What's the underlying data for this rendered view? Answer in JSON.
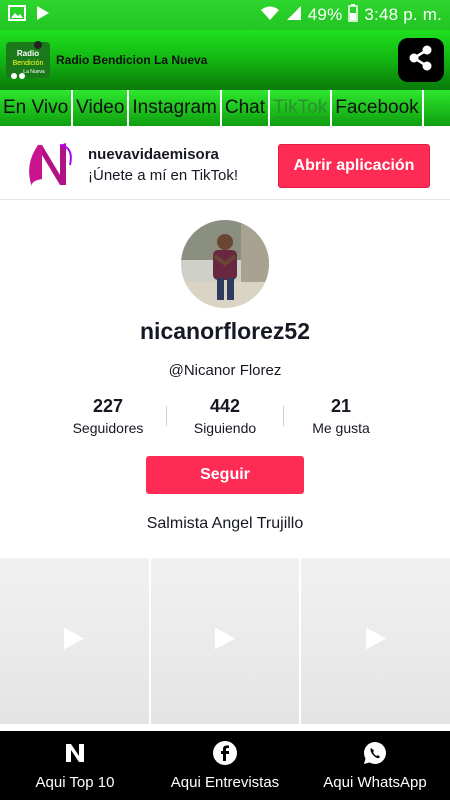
{
  "status_bar": {
    "battery": "49%",
    "time": "3:48 p. m.",
    "icons": [
      "image-icon",
      "play-icon",
      "wifi-icon",
      "signal-icon",
      "battery-icon"
    ]
  },
  "header": {
    "logo_text": "Radio Bendicion La Nueva",
    "title": "Radio Bendicion La Nueva",
    "share_icon": "share-icon"
  },
  "tabs": [
    {
      "label": "En Vivo"
    },
    {
      "label": "Video"
    },
    {
      "label": "Instagram"
    },
    {
      "label": "Chat"
    },
    {
      "label": "TikTok",
      "active": true
    },
    {
      "label": "Facebook"
    }
  ],
  "promo": {
    "account": "nuevavidaemisora",
    "tagline": "¡Únete a mí en TikTok!",
    "open_label": "Abrir aplicación"
  },
  "profile": {
    "username": "nicanorflorez52",
    "handle": "@Nicanor Florez",
    "stats": [
      {
        "value": "227",
        "label": "Seguidores"
      },
      {
        "value": "442",
        "label": "Siguiendo"
      },
      {
        "value": "21",
        "label": "Me gusta"
      }
    ],
    "follow_label": "Seguir",
    "bio": "Salmista Angel Trujillo"
  },
  "videos": [
    {
      "icon": "play-icon"
    },
    {
      "icon": "play-icon"
    },
    {
      "icon": "play-icon"
    }
  ],
  "bottom_nav": [
    {
      "label": "Aqui Top 10",
      "icon": "n-logo-icon"
    },
    {
      "label": "Aqui Entrevistas",
      "icon": "facebook-icon"
    },
    {
      "label": "Aqui WhatsApp",
      "icon": "whatsapp-icon"
    }
  ],
  "colors": {
    "status_green": "#22c522",
    "tiktok_red": "#fe2c55",
    "nav_black": "#000000"
  }
}
